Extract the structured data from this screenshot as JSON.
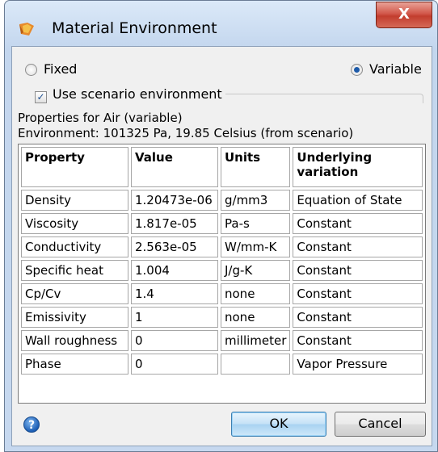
{
  "window": {
    "title": "Material Environment",
    "close_glyph": "X"
  },
  "mode": {
    "fixed_label": "Fixed",
    "variable_label": "Variable",
    "selected": "Variable"
  },
  "use_scenario": {
    "label": "Use scenario environment",
    "checked": true
  },
  "info": {
    "properties_for": "Properties for Air (variable)",
    "environment": "Environment: 101325 Pa, 19.85 Celsius (from scenario)"
  },
  "table": {
    "headers": [
      "Property",
      "Value",
      "Units",
      "Underlying variation"
    ],
    "rows": [
      [
        "Density",
        "1.20473e-06",
        "g/mm3",
        "Equation of State"
      ],
      [
        "Viscosity",
        "1.817e-05",
        "Pa-s",
        "Constant"
      ],
      [
        "Conductivity",
        "2.563e-05",
        "W/mm-K",
        "Constant"
      ],
      [
        "Specific heat",
        "1.004",
        "J/g-K",
        "Constant"
      ],
      [
        "Cp/Cv",
        "1.4",
        "none",
        "Constant"
      ],
      [
        "Emissivity",
        "1",
        "none",
        "Constant"
      ],
      [
        "Wall roughness",
        "0",
        "millimeter",
        "Constant"
      ],
      [
        "Phase",
        "0",
        "",
        "Vapor Pressure"
      ]
    ]
  },
  "buttons": {
    "ok": "OK",
    "cancel": "Cancel",
    "help_glyph": "?"
  },
  "icons": {
    "app": "material-app-icon",
    "help": "help-icon",
    "close": "close-icon"
  },
  "colors": {
    "accent": "#1d5aa8",
    "close_red": "#c23d2e"
  }
}
